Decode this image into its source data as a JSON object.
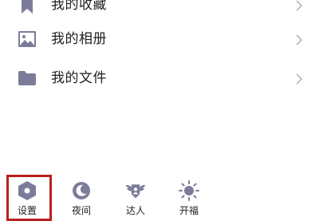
{
  "menu": {
    "items": [
      {
        "label": "我的收藏",
        "icon": "bookmark-icon"
      },
      {
        "label": "我的相册",
        "icon": "image-icon"
      },
      {
        "label": "我的文件",
        "icon": "folder-icon"
      }
    ]
  },
  "toolbar": {
    "items": [
      {
        "label": "设置",
        "icon": "settings-hexagon-icon"
      },
      {
        "label": "夜间",
        "icon": "moon-icon"
      },
      {
        "label": "达人",
        "icon": "winged-badge-icon"
      },
      {
        "label": "开福",
        "icon": "sun-icon"
      }
    ],
    "highlighted": "设置"
  },
  "colors": {
    "icon": "#7c7c9a",
    "text": "#1f1f1f",
    "chevron": "#b0b0b0",
    "highlight_border": "#b8201f",
    "background": "#ffffff"
  }
}
